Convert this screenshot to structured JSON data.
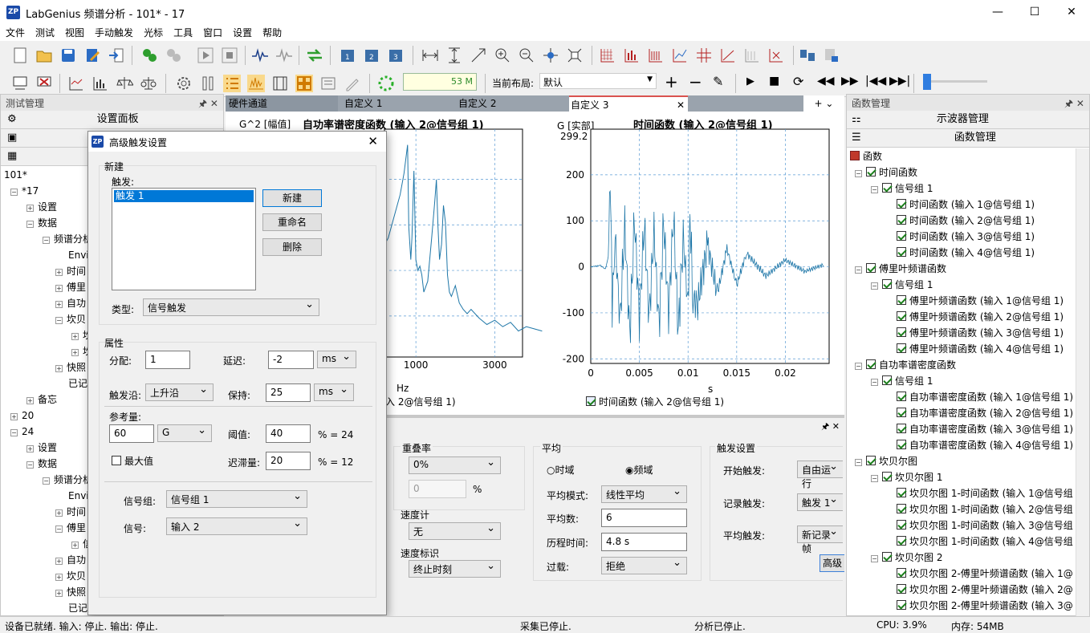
{
  "app": {
    "title": "LabGenius 频谱分析 - 101* - 17",
    "logo": "ZP"
  },
  "menu": [
    "文件",
    "测试",
    "视图",
    "手动触发",
    "光标",
    "工具",
    "窗口",
    "设置",
    "帮助"
  ],
  "toolbar": {
    "value_display": "53 M",
    "layout_label": "当前布局:",
    "layout_value": "默认"
  },
  "left_panel": {
    "title": "测试管理",
    "settings_panel": "设置面板",
    "tree": [
      "101*",
      "*17",
      "设置",
      "数据",
      "频谱分析",
      "Envir",
      "时间",
      "傅里",
      "自功",
      "坎贝",
      "坎",
      "坎",
      "快照",
      "已记",
      "备忘",
      "20",
      "24",
      "设置",
      "数据",
      "频谱分析",
      "Envir",
      "时间",
      "傅里",
      "信",
      "自功",
      "坎贝",
      "快照",
      "已记"
    ]
  },
  "dialog": {
    "title": "高级触发设置",
    "new_section": "新建",
    "trigger_label": "触发:",
    "trigger_items": [
      "触发 1"
    ],
    "buttons": {
      "new": "新建",
      "rename": "重命名",
      "delete": "删除"
    },
    "type_label": "类型:",
    "type_value": "信号触发",
    "props_section": "属性",
    "assign_label": "分配:",
    "assign_value": "1",
    "delay_label": "延迟:",
    "delay_value": "-2",
    "delay_unit": "ms",
    "edge_label": "触发沿:",
    "edge_value": "上升沿",
    "hold_label": "保持:",
    "hold_value": "25",
    "hold_unit": "ms",
    "ref_label": "参考量:",
    "ref_value": "60",
    "ref_unit": "G",
    "threshold_label": "阈值:",
    "threshold_value": "40",
    "threshold_pct": "% = 24",
    "max_label": "最大值",
    "hyst_label": "迟滞量:",
    "hyst_value": "20",
    "hyst_pct": "% = 12",
    "group_label": "信号组:",
    "group_value": "信号组 1",
    "signal_label": "信号:",
    "signal_value": "输入 2"
  },
  "tabs": [
    "硬件通道",
    "自定义 1",
    "自定义 2",
    "自定义 3"
  ],
  "chart_left": {
    "ylabel": "G^2 [幅值]",
    "title": "自功率谱密度函数 (输入 2@信号组 1)",
    "xlabel": "Hz",
    "xticks": [
      "1000",
      "3000"
    ],
    "legend": "入 2@信号组 1)"
  },
  "chart_right": {
    "ylabel": "G [实部]",
    "ymax_label": "299.2",
    "title": "时间函数 (输入 2@信号组 1)",
    "xlabel": "s",
    "legend": "时间函数 (输入 2@信号组 1)",
    "xticks": [
      "0",
      "0.005",
      "0.01",
      "0.015",
      "0.02"
    ],
    "yticks": [
      "200",
      "100",
      "0",
      "-100",
      "-200"
    ]
  },
  "chart_data": [
    {
      "type": "line",
      "title": "自功率谱密度函数 (输入 2@信号组 1)",
      "xlabel": "Hz",
      "ylabel": "G^2 [幅值]",
      "x_ticks": [
        1000,
        3000
      ],
      "series": [
        {
          "name": "入 2@信号组 1)",
          "x": [
            0,
            300,
            600,
            700,
            790,
            820,
            870,
            900,
            950,
            1000,
            1050,
            1100,
            1150,
            1200,
            1300,
            1400,
            1480,
            1520,
            1560,
            1600,
            1650,
            1700,
            1750,
            1800,
            1850,
            1900,
            2000,
            2100,
            2200,
            2300,
            2400,
            2600,
            2800,
            3000,
            3200,
            3400,
            3600,
            3800,
            4000,
            4200
          ],
          "values": [
            0.45,
            0.55,
            0.75,
            0.85,
            0.98,
            0.6,
            0.45,
            0.55,
            0.86,
            0.45,
            0.4,
            0.42,
            0.38,
            0.3,
            0.35,
            0.55,
            0.72,
            0.82,
            0.6,
            0.45,
            0.52,
            0.7,
            0.62,
            0.38,
            0.3,
            0.28,
            0.33,
            0.25,
            0.22,
            0.2,
            0.22,
            0.18,
            0.15,
            0.17,
            0.14,
            0.16,
            0.12,
            0.14,
            0.13,
            0.12
          ]
        }
      ]
    },
    {
      "type": "line",
      "title": "时间函数 (输入 2@信号组 1)",
      "xlabel": "s",
      "ylabel": "G [实部]",
      "ylim": [
        -210,
        299.2
      ],
      "series": [
        {
          "name": "时间函数 (输入 2@信号组 1)",
          "x": [
            0,
            0.001,
            0.0015,
            0.0018,
            0.002,
            0.0022,
            0.0025,
            0.003,
            0.0035,
            0.004,
            0.0045,
            0.005,
            0.0055,
            0.006,
            0.0065,
            0.007,
            0.0075,
            0.008,
            0.0085,
            0.009,
            0.0095,
            0.01,
            0.0102,
            0.0105,
            0.011,
            0.012,
            0.013,
            0.014,
            0.015,
            0.016,
            0.018,
            0.02,
            0.022,
            0.024
          ],
          "values": [
            0,
            3,
            -5,
            20,
            210,
            -90,
            70,
            -120,
            90,
            -150,
            100,
            -110,
            95,
            -110,
            80,
            -130,
            95,
            -100,
            110,
            -140,
            70,
            -90,
            115,
            -70,
            -80,
            50,
            -60,
            40,
            -40,
            30,
            -20,
            15,
            -10,
            5
          ]
        }
      ]
    }
  ],
  "right_panel": {
    "title": "函数管理",
    "osc": "示波器管理",
    "func_mgr": "函数管理",
    "tree": [
      {
        "t": "函数",
        "lv": 0
      },
      {
        "t": "时间函数",
        "lv": 1
      },
      {
        "t": "信号组 1",
        "lv": 2
      },
      {
        "t": "时间函数 (输入 1@信号组 1)",
        "lv": 3
      },
      {
        "t": "时间函数 (输入 2@信号组 1)",
        "lv": 3
      },
      {
        "t": "时间函数 (输入 3@信号组 1)",
        "lv": 3
      },
      {
        "t": "时间函数 (输入 4@信号组 1)",
        "lv": 3
      },
      {
        "t": "傅里叶频谱函数",
        "lv": 1
      },
      {
        "t": "信号组 1",
        "lv": 2
      },
      {
        "t": "傅里叶频谱函数 (输入 1@信号组 1)",
        "lv": 3
      },
      {
        "t": "傅里叶频谱函数 (输入 2@信号组 1)",
        "lv": 3
      },
      {
        "t": "傅里叶频谱函数 (输入 3@信号组 1)",
        "lv": 3
      },
      {
        "t": "傅里叶频谱函数 (输入 4@信号组 1)",
        "lv": 3
      },
      {
        "t": "自功率谱密度函数",
        "lv": 1
      },
      {
        "t": "信号组 1",
        "lv": 2
      },
      {
        "t": "自功率谱密度函数 (输入 1@信号组 1)",
        "lv": 3
      },
      {
        "t": "自功率谱密度函数 (输入 2@信号组 1)",
        "lv": 3
      },
      {
        "t": "自功率谱密度函数 (输入 3@信号组 1)",
        "lv": 3
      },
      {
        "t": "自功率谱密度函数 (输入 4@信号组 1)",
        "lv": 3
      },
      {
        "t": "坎贝尔图",
        "lv": 1
      },
      {
        "t": "坎贝尔图 1",
        "lv": 2
      },
      {
        "t": "坎贝尔图 1-时间函数 (输入 1@信号组",
        "lv": 3
      },
      {
        "t": "坎贝尔图 1-时间函数 (输入 2@信号组",
        "lv": 3
      },
      {
        "t": "坎贝尔图 1-时间函数 (输入 3@信号组",
        "lv": 3
      },
      {
        "t": "坎贝尔图 1-时间函数 (输入 4@信号组",
        "lv": 3
      },
      {
        "t": "坎贝尔图 2",
        "lv": 2
      },
      {
        "t": "坎贝尔图 2-傅里叶频谱函数 (输入 1@",
        "lv": 3
      },
      {
        "t": "坎贝尔图 2-傅里叶频谱函数 (输入 2@",
        "lv": 3
      },
      {
        "t": "坎贝尔图 2-傅里叶频谱函数 (输入 3@",
        "lv": 3
      }
    ]
  },
  "bottom": {
    "overlap_label": "重叠率",
    "overlap_value": "0%",
    "overlap_input": "0",
    "overlap_unit": "%",
    "speed_label": "速度计",
    "speed_value": "无",
    "speed_mark_label": "速度标识",
    "speed_mark_value": "终止时刻",
    "avg_label": "平均",
    "time_domain": "时域",
    "freq_domain": "频域",
    "avg_mode_label": "平均模式:",
    "avg_mode_value": "线性平均",
    "avg_count_label": "平均数:",
    "avg_count_value": "6",
    "history_label": "历程时间:",
    "history_value": "4.8 s",
    "overload_label": "过载:",
    "overload_value": "拒绝",
    "trig_label": "触发设置",
    "start_trig_label": "开始触发:",
    "start_trig_value": "自由运行",
    "rec_trig_label": "记录触发:",
    "rec_trig_value": "触发 1",
    "avg_trig_label": "平均触发:",
    "avg_trig_value": "新记录帧",
    "adv_btn": "高级"
  },
  "status": {
    "device": "设备已就绪. 输入: 停止. 输出: 停止.",
    "acq": "采集已停止.",
    "analysis": "分析已停止.",
    "cpu": "CPU: 3.9%",
    "mem": "内存: 54MB"
  }
}
